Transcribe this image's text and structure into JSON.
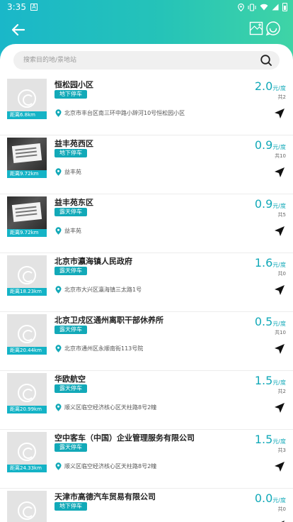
{
  "status_bar": {
    "time": "3:35",
    "notif": "A"
  },
  "search": {
    "placeholder": "搜索目的地/景地站"
  },
  "lots": [
    {
      "name": "恒松园小区",
      "type": "地下停车",
      "address": "北京市丰台区南三环中路小辞河10号恒松园小区",
      "distance": "距离6.8km",
      "price": "2.0",
      "unit": "元/度",
      "count": "共2",
      "photo": false
    },
    {
      "name": "益丰苑西区",
      "type": "地下停车",
      "address": "益丰苑",
      "distance": "距离9.72km",
      "price": "0.9",
      "unit": "元/度",
      "count": "共10",
      "photo": true
    },
    {
      "name": "益丰苑东区",
      "type": "露天停车",
      "address": "益丰苑",
      "distance": "距离9.72km",
      "price": "0.9",
      "unit": "元/度",
      "count": "共5",
      "photo": true
    },
    {
      "name": "北京市瀛海镇人民政府",
      "type": "露天停车",
      "address": "北京市大兴区瀛海镇三太路1号",
      "distance": "距离18.23km",
      "price": "1.6",
      "unit": "元/度",
      "count": "共0",
      "photo": false
    },
    {
      "name": "北京卫戍区通州离职干部休养所",
      "type": "露天停车",
      "address": "北京市通州区永顺南街113号院",
      "distance": "距离20.44km",
      "price": "0.5",
      "unit": "元/度",
      "count": "共10",
      "photo": false
    },
    {
      "name": "华欧航空",
      "type": "露天停车",
      "address": "顺义区临空经济核心区天柱路8号2幢",
      "distance": "距离20.99km",
      "price": "1.5",
      "unit": "元/度",
      "count": "共2",
      "photo": false
    },
    {
      "name": "空中客车（中国）企业管理服务有限公司",
      "type": "露天停车",
      "address": "顺义区临空经济核心区天柱路8号2幢",
      "distance": "距离24.33km",
      "price": "1.5",
      "unit": "元/度",
      "count": "共3",
      "photo": false
    },
    {
      "name": "天津市高德汽车贸易有限公司",
      "type": "地下停车",
      "address": "",
      "distance": "",
      "price": "0.0",
      "unit": "元/度",
      "count": "共0",
      "photo": false
    }
  ],
  "colors": {
    "accent": "#12a9b8",
    "header_start": "#1ab7c9",
    "header_end": "#3fd4a6"
  },
  "icons": {
    "back": "arrow-left-icon",
    "map": "map-icon",
    "chat": "chat-icon",
    "search": "search-icon",
    "pin": "location-pin-icon",
    "nav": "navigation-arrow-icon",
    "placeholder": "image-placeholder-icon"
  }
}
